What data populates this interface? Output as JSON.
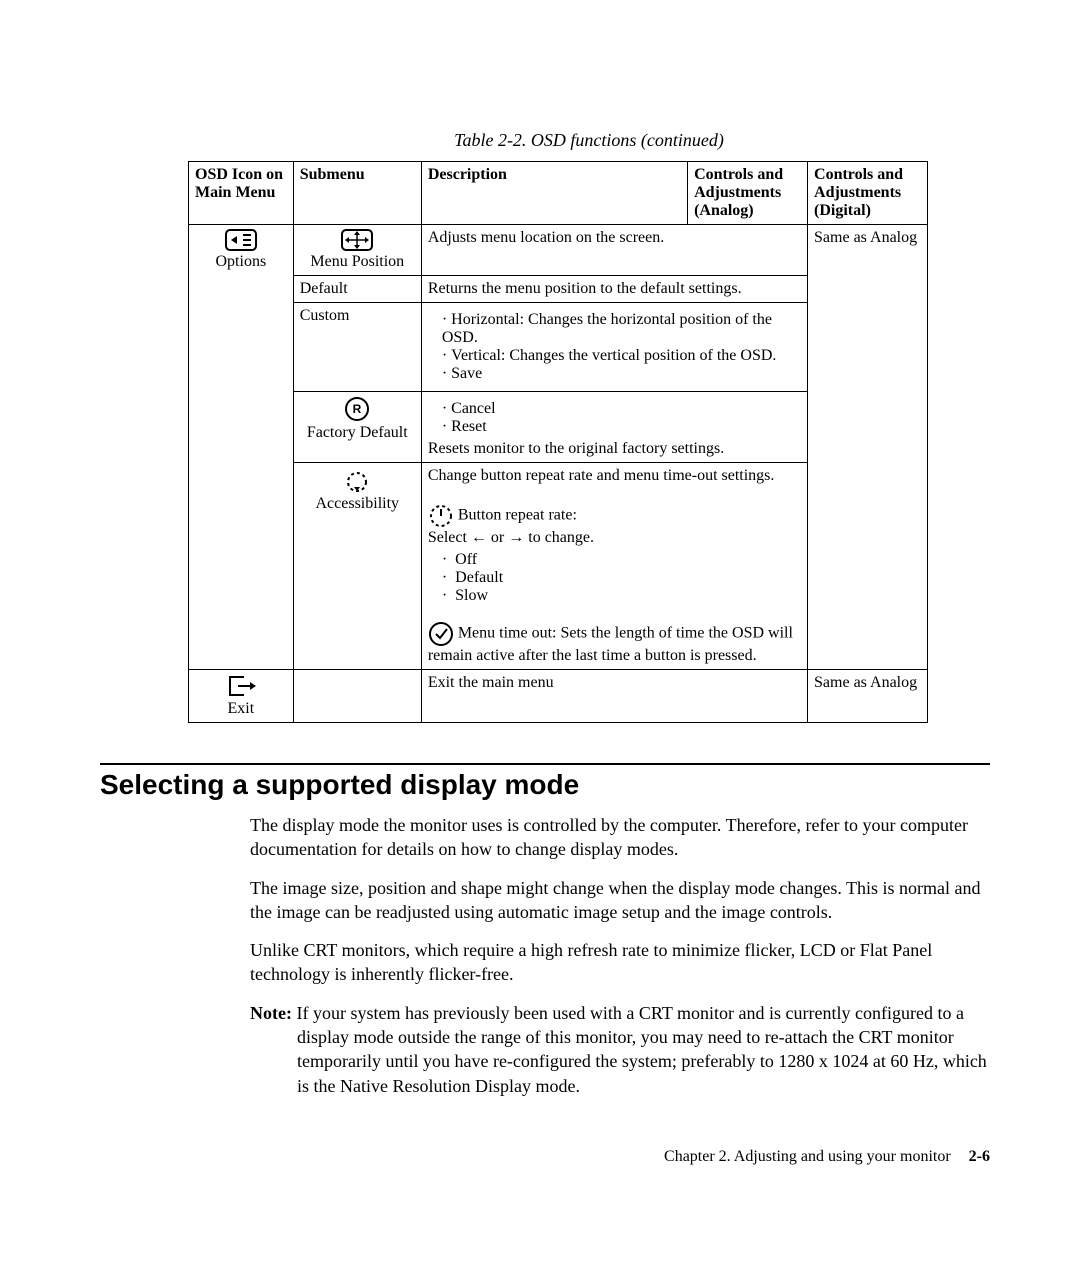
{
  "caption": "Table 2-2. OSD functions (continued)",
  "headers": {
    "c1": "OSD Icon on Main Menu",
    "c2": "Submenu",
    "c3": "Description",
    "c4": "Controls and Adjustments (Analog)",
    "c5": "Controls and Adjustments (Digital)"
  },
  "options": {
    "main_label": "Options",
    "digital": "Same as Analog",
    "menu_position": {
      "sub_label": "Menu Position",
      "desc": "Adjusts menu location on the screen."
    },
    "default_row": {
      "sub_label": "Default",
      "desc": "Returns the menu position to the default settings."
    },
    "custom": {
      "sub_label": "Custom",
      "b1": "Horizontal: Changes the horizontal position of the OSD.",
      "b2": "Vertical: Changes the vertical position of the OSD.",
      "b3": "Save"
    },
    "factory": {
      "sub_label": "Factory Default",
      "b1": "Cancel",
      "b2": "Reset",
      "tail": "Resets monitor to the original factory settings."
    },
    "accessibility": {
      "sub_label": "Accessibility",
      "intro": "Change button repeat rate and menu time-out settings.",
      "repeat_label": "Button repeat rate:",
      "select_text_pre": "Select",
      "select_text_mid": "or",
      "select_text_post": "to change.",
      "opt1": "Off",
      "opt2": "Default",
      "opt3": "Slow",
      "timeout_text": "Menu time out: Sets the length of time the OSD will remain active after the last time a button is pressed."
    }
  },
  "exit": {
    "main_label": "Exit",
    "desc": "Exit the main menu",
    "digital": "Same as Analog"
  },
  "section_title": "Selecting a supported display mode",
  "p1": "The display mode the monitor uses is controlled by the computer. Therefore, refer to your computer documentation for details on how to change display modes.",
  "p2": "The image size, position and shape might change when the display mode changes. This is normal and the image can be readjusted using automatic image setup and the image controls.",
  "p3": "Unlike CRT monitors, which require a high refresh rate to minimize flicker, LCD or Flat Panel technology is inherently flicker-free.",
  "note_label": "Note:",
  "note_text": " If your system has previously been used with a CRT monitor and is currently configured to a display mode outside the range of this monitor, you may need to re-attach the CRT monitor temporarily until you have re-configured the system; preferably to 1280 x 1024 at 60 Hz, which is the Native Resolution Display mode.",
  "footer_text": "Chapter 2. Adjusting and using your monitor",
  "footer_page": "2-6"
}
